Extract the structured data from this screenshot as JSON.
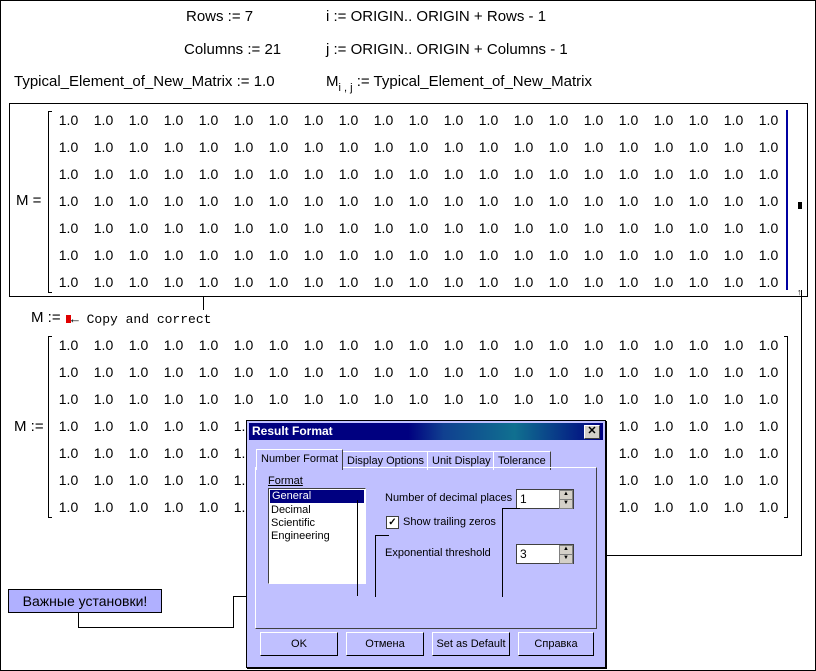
{
  "definitions": {
    "rows": "Rows := 7",
    "i_range": "i := ORIGIN.. ORIGIN +  Rows - 1",
    "columns": "Columns  := 21",
    "j_range": "j := ORIGIN.. ORIGIN +  Columns - 1",
    "typical": "Typical_Element_of_New_Matrix  := 1.0",
    "m_base": "M",
    "m_sub": "i , j",
    "m_assign": " := Typical_Element_of_New_Matrix"
  },
  "result_matrix": {
    "label": "M =",
    "rows": 7,
    "cols": 21,
    "value": "1.0"
  },
  "copy_line": {
    "label": "M :=",
    "comment": "← Copy and correct"
  },
  "assign_matrix": {
    "label": "M :=",
    "rows": 7,
    "cols": 21,
    "value": "1.0"
  },
  "dialog": {
    "title": "Result Format",
    "close": "✕",
    "tabs": [
      "Number Format",
      "Display Options",
      "Unit Display",
      "Tolerance"
    ],
    "format_label": "Format",
    "format_options": [
      "General",
      "Decimal",
      "Scientific",
      "Engineering"
    ],
    "selected_format": "General",
    "decimal_places_label": "Number of decimal places",
    "decimal_places_value": "1",
    "trailing_zeros_label": "Show trailing zeros",
    "trailing_zeros_checked": true,
    "exp_threshold_label": "Exponential threshold",
    "exp_threshold_value": "3",
    "buttons": {
      "ok": "OK",
      "cancel": "Отмена",
      "default": "Set as Default",
      "help": "Справка"
    }
  },
  "note": "Важные установки!",
  "colors": {
    "dialog_bg": "#c0c0ff",
    "title_bar": "#000080",
    "placeholder": "#e00000",
    "note_bg": "#b0b0ff"
  }
}
